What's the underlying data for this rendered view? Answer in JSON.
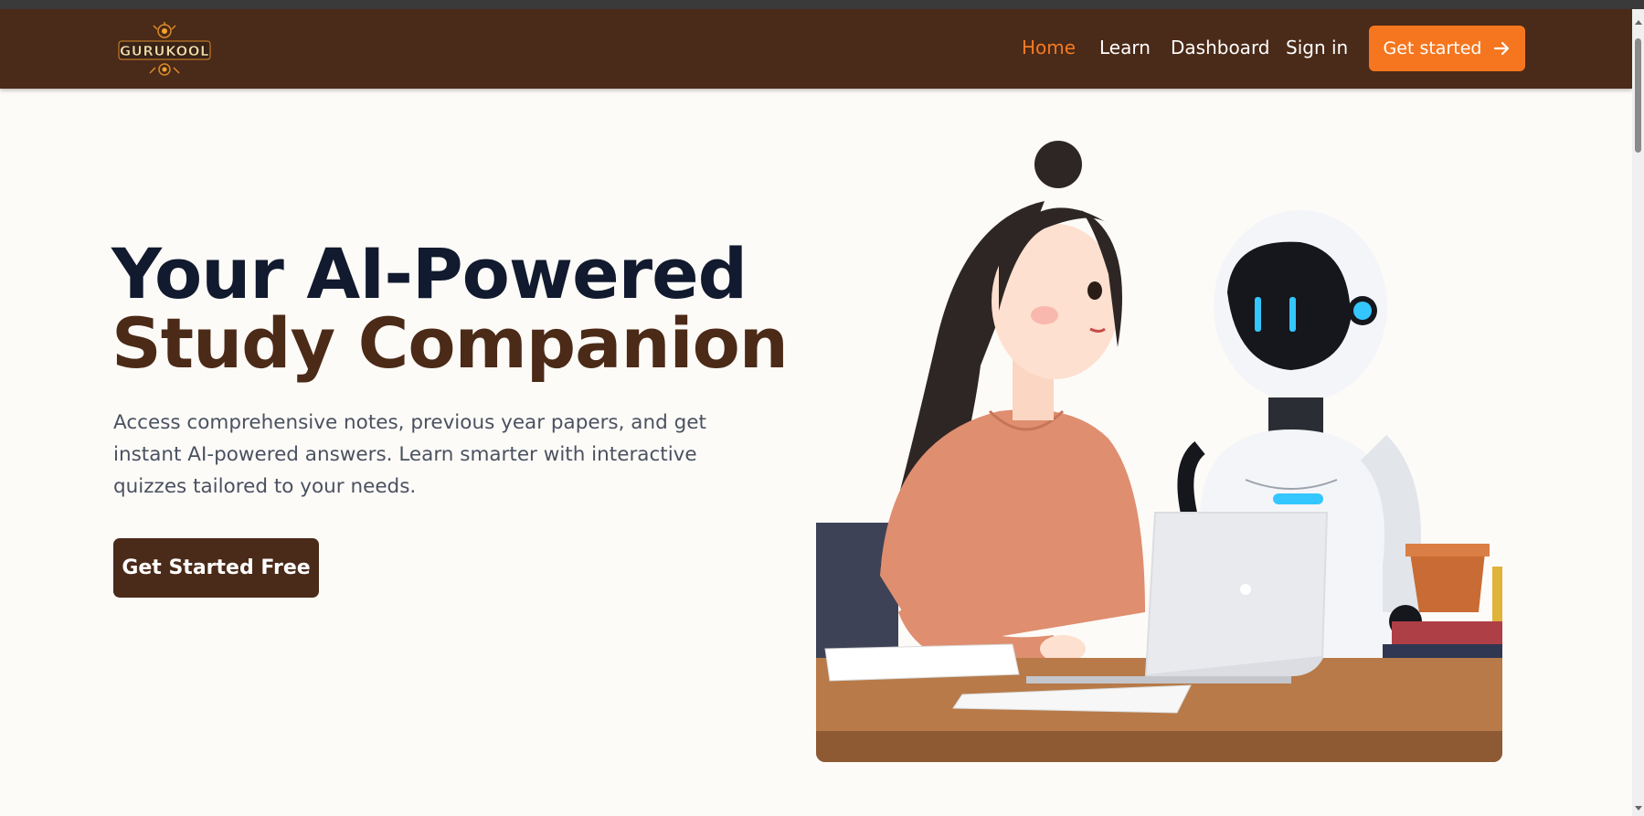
{
  "header": {
    "logo_text": "GURUKOOL",
    "nav": [
      {
        "label": "Home",
        "active": true
      },
      {
        "label": "Learn",
        "active": false
      },
      {
        "label": "Dashboard",
        "active": false
      },
      {
        "label": "Sign in",
        "active": false
      }
    ],
    "cta_label": "Get started",
    "cta_icon": "arrow-right-icon"
  },
  "hero": {
    "title_line1": "Your AI-Powered",
    "title_line2": "Study Companion",
    "subtitle": "Access comprehensive notes, previous year papers, and get instant AI-powered answers. Learn smarter with interactive quizzes tailored to your needs.",
    "cta_label": "Get Started Free",
    "image_subject": "woman-and-robot-studying-illustration"
  },
  "colors": {
    "nav_bg": "#4a2a18",
    "accent": "#f5761f",
    "active_link": "#f47a23",
    "title_dark": "#111a2e",
    "title_brown": "#4b2a17",
    "page_bg": "#fdfbf8"
  }
}
